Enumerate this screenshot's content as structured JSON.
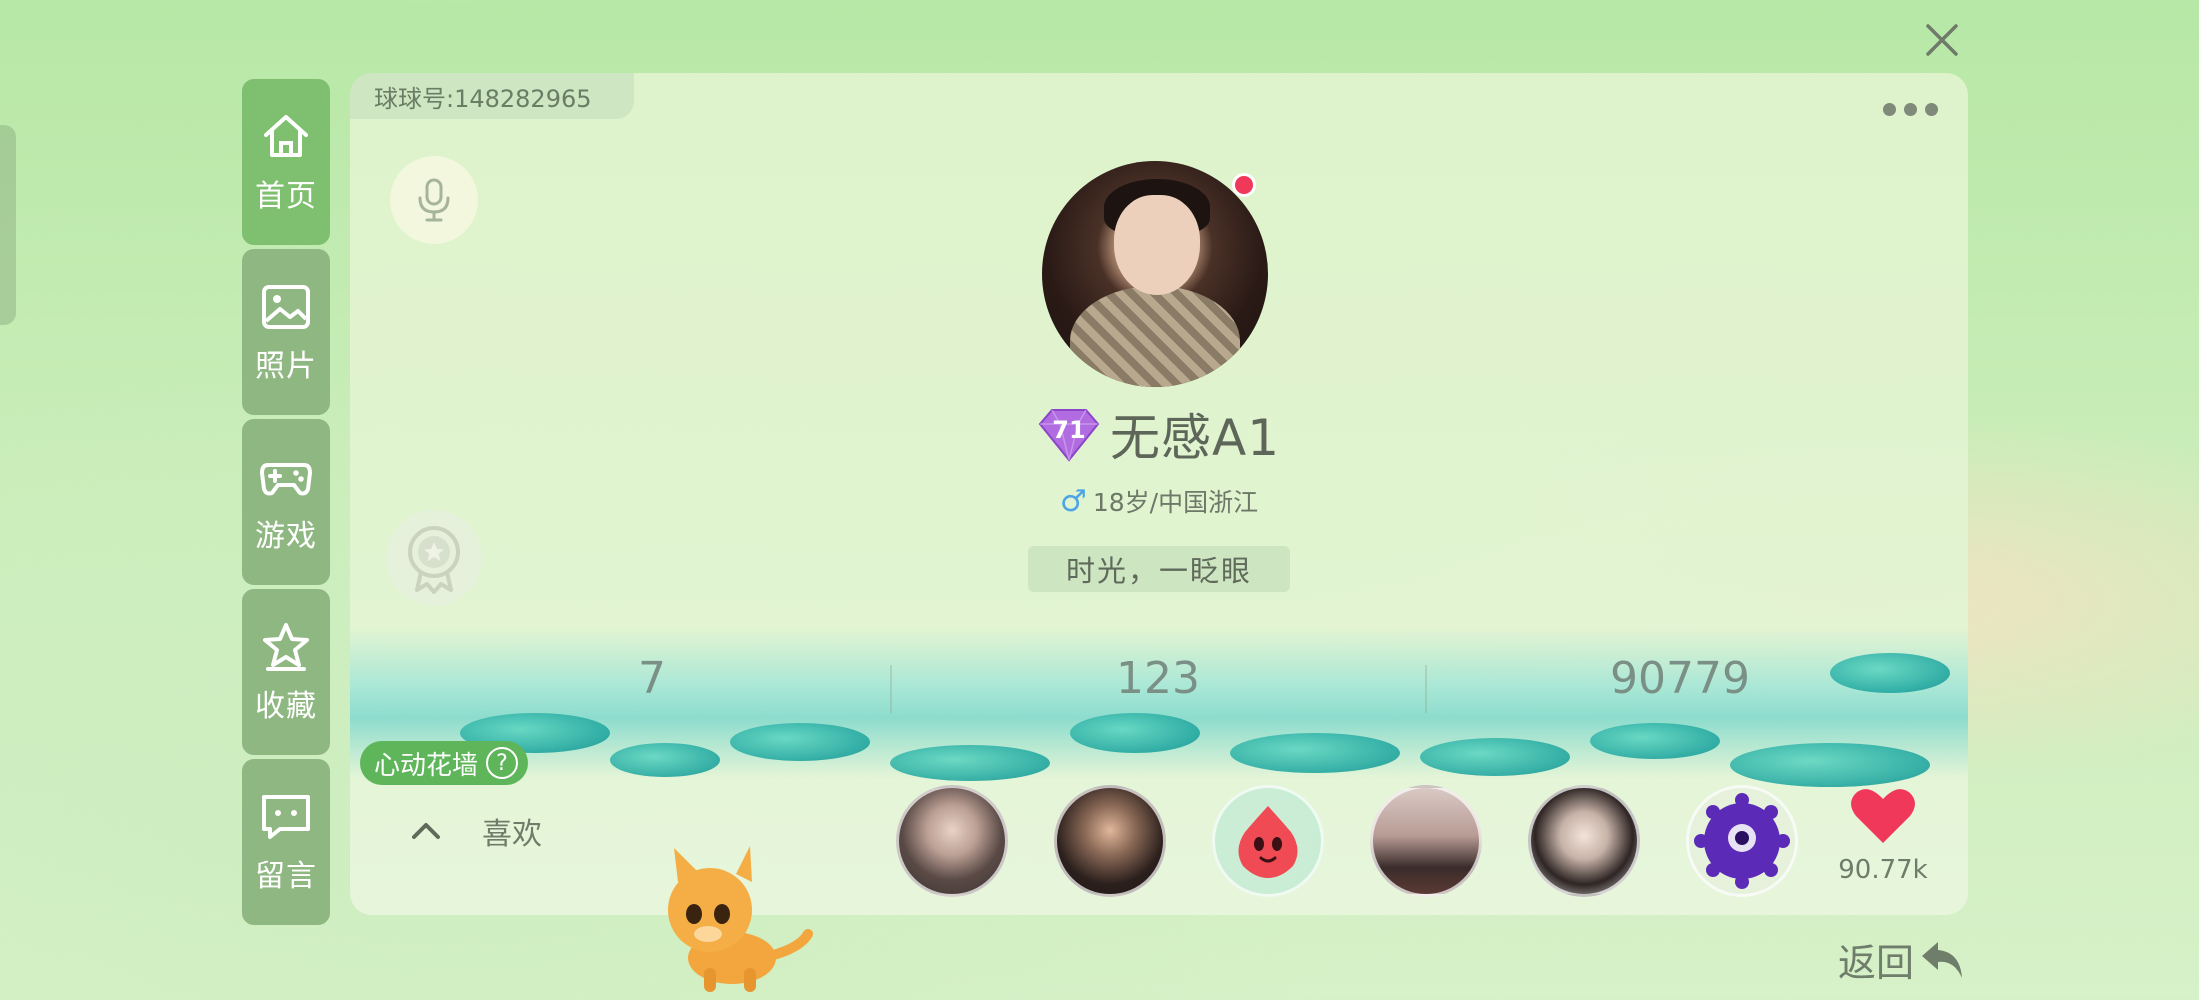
{
  "header": {
    "qq_id_label": "球球号:148282965"
  },
  "nav": {
    "items": [
      {
        "label": "首页",
        "icon": "home-icon"
      },
      {
        "label": "照片",
        "icon": "photo-icon"
      },
      {
        "label": "游戏",
        "icon": "gamepad-icon"
      },
      {
        "label": "收藏",
        "icon": "collection-icon"
      },
      {
        "label": "留言",
        "icon": "message-icon"
      }
    ]
  },
  "profile": {
    "level": "71",
    "username": "无感A1",
    "gender_icon": "♂",
    "age_location": "18岁/中国浙江",
    "signature": "时光，一眨眼",
    "online": true
  },
  "stats": {
    "values": [
      "7",
      "123",
      "90779"
    ]
  },
  "heart_wall": {
    "label": "心动花墙",
    "help": "?"
  },
  "likes": {
    "toggle_icon": "chevron-up-icon",
    "label": "喜欢",
    "count": "90.77k",
    "liker_count_shown": 6
  },
  "footer": {
    "back_label": "返回"
  },
  "colors": {
    "accent_green": "#7fc070",
    "nav_bg": "#8fb782",
    "heart_red": "#f0385a",
    "male_blue": "#4ea4e6",
    "level_purple": "#b06ce0"
  }
}
